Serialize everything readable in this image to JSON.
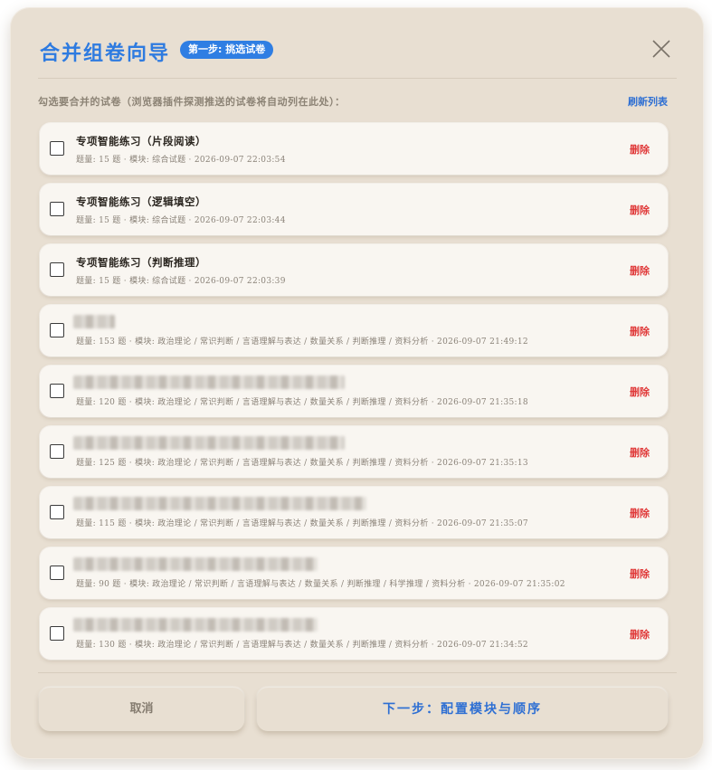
{
  "dialog": {
    "title": "合并组卷向导",
    "step_badge": "第一步: 挑选试卷",
    "hint": "勾选要合并的试卷（浏览器插件探测推送的试卷将自动列在此处）：",
    "refresh_label": "刷新列表",
    "delete_label": "删除",
    "icons": {
      "close": "close-icon"
    }
  },
  "papers": [
    {
      "name": "专项智能练习（片段阅读）",
      "meta": "题量: 15 题 · 模块: 综合试题 · 2026-09-07 22:03:54",
      "checked": false
    },
    {
      "name": "专项智能练习（逻辑填空）",
      "meta": "题量: 15 题 · 模块: 综合试题 · 2026-09-07 22:03:44",
      "checked": false
    },
    {
      "name": "专项智能练习（判断推理）",
      "meta": "题量: 15 题 · 模块: 综合试题 · 2026-09-07 22:03:39",
      "checked": false
    },
    {
      "name": "",
      "meta": "题量: 153 题 · 模块: 政治理论 / 常识判断 / 言语理解与表达 / 数量关系 / 判断推理 / 资料分析 · 2026-09-07 21:49:12",
      "checked": false
    },
    {
      "name": "",
      "meta": "题量: 120 题 · 模块: 政治理论 / 常识判断 / 言语理解与表达 / 数量关系 / 判断推理 / 资料分析 · 2026-09-07 21:35:18",
      "checked": false
    },
    {
      "name": "",
      "meta": "题量: 125 题 · 模块: 政治理论 / 常识判断 / 言语理解与表达 / 数量关系 / 判断推理 / 资料分析 · 2026-09-07 21:35:13",
      "checked": false
    },
    {
      "name": "",
      "meta": "题量: 115 题 · 模块: 政治理论 / 常识判断 / 言语理解与表达 / 数量关系 / 判断推理 / 资料分析 · 2026-09-07 21:35:07",
      "checked": false
    },
    {
      "name": "",
      "meta": "题量: 90 题 · 模块: 政治理论 / 常识判断 / 言语理解与表达 / 数量关系 / 判断推理 / 科学推理 / 资料分析 · 2026-09-07 21:35:02",
      "checked": false
    },
    {
      "name": "",
      "meta": "题量: 130 题 · 模块: 政治理论 / 常识判断 / 言语理解与表达 / 数量关系 / 判断推理 / 资料分析 · 2026-09-07 21:34:52",
      "checked": false
    }
  ],
  "footer": {
    "cancel_label": "取消",
    "next_label": "下一步：配置模块与顺序"
  }
}
